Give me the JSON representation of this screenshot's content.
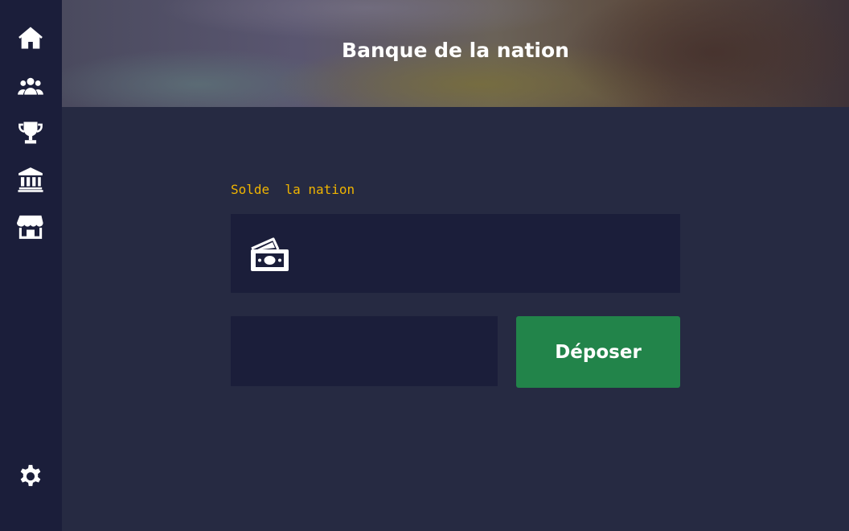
{
  "header": {
    "title": "Banque de la nation"
  },
  "sidebar": {
    "items": [
      {
        "icon": "home-icon"
      },
      {
        "icon": "users-icon"
      },
      {
        "icon": "trophy-icon"
      },
      {
        "icon": "bank-icon"
      },
      {
        "icon": "shop-icon"
      }
    ],
    "settings_icon": "gear-icon"
  },
  "balance": {
    "label": "Solde  la nation",
    "icon": "money-bill-icon",
    "value": ""
  },
  "deposit": {
    "input_value": "",
    "input_placeholder": "",
    "button_label": "Déposer"
  },
  "colors": {
    "sidebar_bg": "#1b1e3a",
    "page_bg": "#262a42",
    "label_accent": "#f0b400",
    "button_green": "#22844a"
  }
}
